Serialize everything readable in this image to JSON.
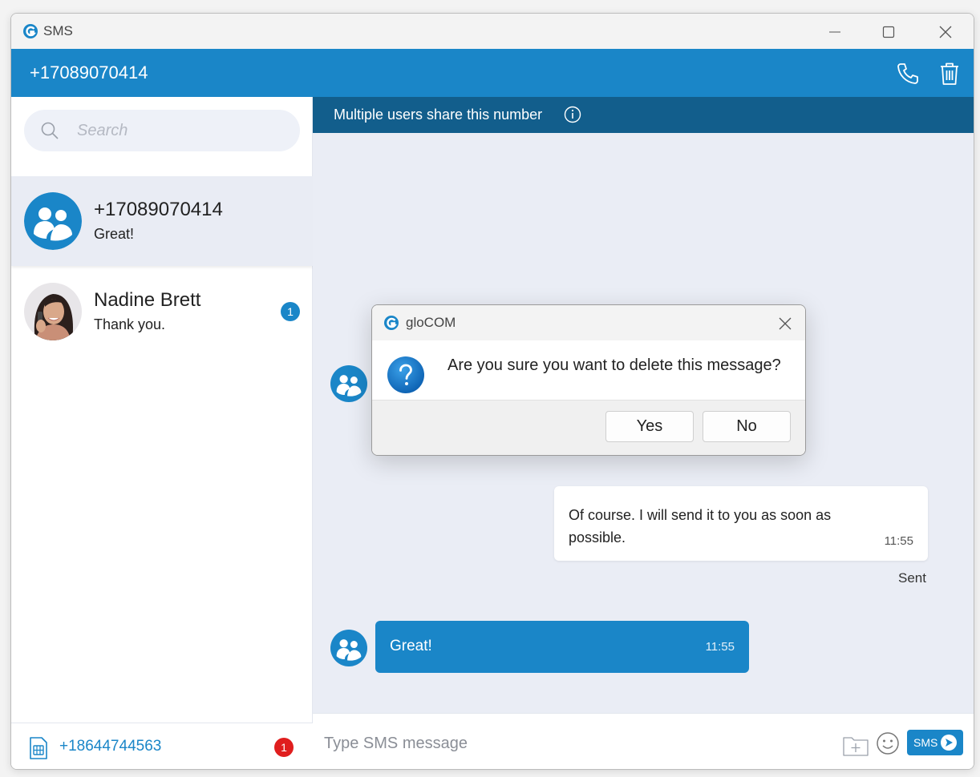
{
  "window": {
    "title": "SMS",
    "logo_icon": "glocom-logo-icon"
  },
  "header": {
    "phone_number": "+17089070414",
    "call_icon": "phone-icon",
    "delete_icon": "trash-icon",
    "color": "#1a86c8"
  },
  "sidebar": {
    "search": {
      "placeholder": "Search"
    },
    "conversations": [
      {
        "name": "+17089070414",
        "preview": "Great!",
        "avatar": "group-avatar-icon",
        "active": true
      },
      {
        "name": "Nadine Brett",
        "preview": "Thank you.",
        "avatar": "user-photo",
        "badge": "1"
      }
    ],
    "footer": {
      "number": "+18644744563",
      "badge": "1",
      "icon": "sim-card-icon"
    }
  },
  "chat": {
    "notice": "Multiple users share this number",
    "messages": [
      {
        "direction": "out",
        "text": "Of course. I will send it to you as soon as possible.",
        "time": "11:55",
        "status": "Sent"
      },
      {
        "direction": "in",
        "text": "Great!",
        "time": "11:55"
      }
    ],
    "composer": {
      "placeholder": "Type SMS message",
      "send_label": "SMS"
    }
  },
  "dialog": {
    "title": "gloCOM",
    "question": "Are you sure you want to delete this message?",
    "yes": "Yes",
    "no": "No"
  },
  "colors": {
    "accent": "#1a86c8",
    "notice_bar": "#125e8c",
    "chat_bg": "#eaedf5",
    "alert_badge": "#e01e1e"
  }
}
